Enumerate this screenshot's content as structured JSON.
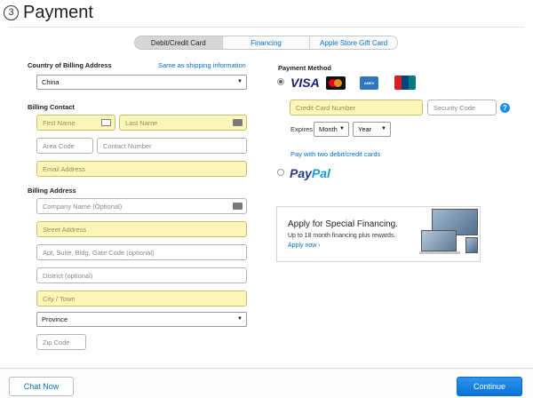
{
  "header": {
    "step_number": "3",
    "title": "Payment"
  },
  "tabs": [
    {
      "label": "Debit/Credit Card",
      "active": true
    },
    {
      "label": "Financing",
      "active": false
    },
    {
      "label": "Apple Store Gift Card",
      "active": false
    }
  ],
  "billing": {
    "country_label": "Country of Billing Address",
    "same_as_shipping": "Same as shipping information",
    "country_value": "China",
    "contact_label": "Billing Contact",
    "first_name_placeholder": "First Name",
    "last_name_placeholder": "Last Name",
    "area_code_placeholder": "Area Code",
    "contact_number_placeholder": "Contact Number",
    "email_placeholder": "Email Address",
    "address_label": "Billing Address",
    "company_placeholder": "Company Name (Optional)",
    "street_placeholder": "Street Address",
    "apt_placeholder": "Apt, Suite, Bldg, Gate Code (optional)",
    "district_placeholder": "District (optional)",
    "city_placeholder": "City / Town",
    "province_value": "Province",
    "zip_placeholder": "Zip Code"
  },
  "payment": {
    "method_label": "Payment Method",
    "visa_text": "VISA",
    "amex_text": "AMEX",
    "card_number_placeholder": "Credit Card Number",
    "security_code_placeholder": "Security Code",
    "expires_label": "Expires",
    "month_value": "Month",
    "year_value": "Year",
    "two_cards_link": "Pay with two debit/credit cards",
    "paypal_part1": "Pay",
    "paypal_part2": "Pal"
  },
  "promo": {
    "title": "Apply for Special Financing.",
    "subtitle": "Up to 18 month financing plus rewards.",
    "link": "Apply now ›"
  },
  "footer": {
    "chat_label": "Chat Now",
    "continue_label": "Continue"
  },
  "colors": {
    "accent": "#0070c9",
    "required_field": "#fbf6ba",
    "continue": "#1a86e8"
  }
}
